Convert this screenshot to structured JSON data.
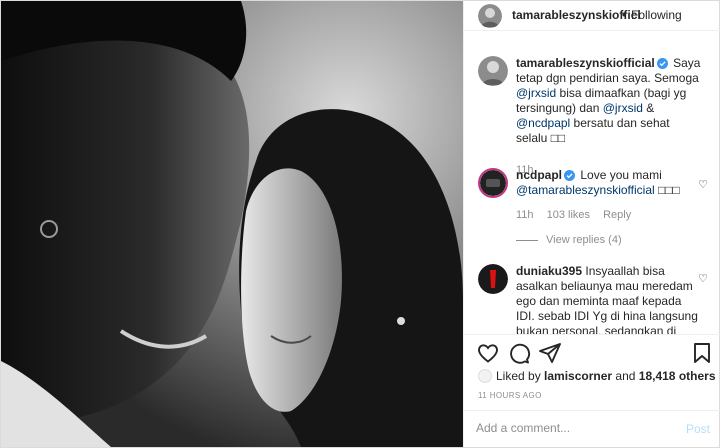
{
  "header": {
    "username": "tamarableszynskiofficial",
    "username_shown": "tamarableszynskiofficl",
    "separator": "•",
    "follow_status": "Following"
  },
  "comments": [
    {
      "username": "tamarableszynskiofficial",
      "verified": true,
      "text_parts": [
        "Saya tetap dgn pendirian saya. Semoga ",
        "@jrxsid",
        " bisa dimaafkan (bagi yg tersingung) dan ",
        "@jrxsid",
        " & ",
        "@ncdpapl",
        " bersatu dan sehat selalu ",
        "□□"
      ],
      "time": "11h"
    },
    {
      "username": "ncdpapl",
      "verified": true,
      "text_parts": [
        "Love you mami ",
        "@tamarableszynskiofficial",
        " □□□"
      ],
      "time": "11h",
      "likes": "103 likes",
      "reply": "Reply",
      "view_replies": "View replies (4)"
    },
    {
      "username": "duniaku395",
      "verified": false,
      "text": "Insyaallah bisa asalkan beliaunya mau meredam ego dan meminta maaf kepada IDI. sebab IDI Yg di hina langsung bukan personal, sedangkan di"
    }
  ],
  "actions": {
    "like_icon": "heart-icon",
    "comment_icon": "comment-icon",
    "share_icon": "share-icon",
    "save_icon": "bookmark-icon"
  },
  "likes": {
    "prefix": "Liked by ",
    "user": "lamiscorner",
    "middle": " and ",
    "others": "18,418 others"
  },
  "timestamp": "11 HOURS AGO",
  "add_comment": {
    "placeholder": "Add a comment...",
    "post_label": "Post"
  },
  "colors": {
    "link": "#00376b",
    "verified": "#3897f0",
    "muted": "#8e8e8e",
    "post_disabled": "#b2dffc"
  }
}
